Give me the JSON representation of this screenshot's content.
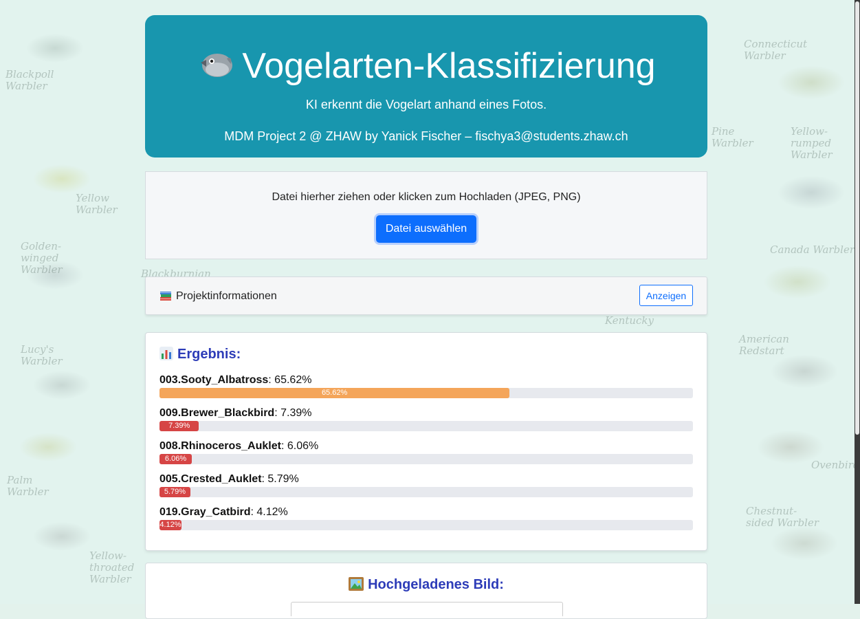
{
  "header": {
    "title": "Vogelarten-Klassifizierung",
    "subtitle": "KI erkennt die Vogelart anhand eines Fotos.",
    "credit": "MDM Project 2 @ ZHAW by Yanick Fischer – fischya3@students.zhaw.ch",
    "icon": "bird-icon",
    "background_color": "#1896ae"
  },
  "upload": {
    "prompt": "Datei hierher ziehen oder klicken zum Hochladen (JPEG, PNG)",
    "button_label": "Datei auswählen",
    "button_color": "#0d6efd"
  },
  "project_info": {
    "label": "Projektinformationen",
    "icon": "books-icon",
    "button_label": "Anzeigen"
  },
  "results": {
    "heading": "Ergebnis:",
    "icon": "bar-chart-icon",
    "heading_color": "#2d3cb8",
    "predictions": [
      {
        "name": "003.Sooty_Albatross",
        "value": "65.62%",
        "percent": 65.62,
        "color": "#f4a55a"
      },
      {
        "name": "009.Brewer_Blackbird",
        "value": "7.39%",
        "percent": 7.39,
        "color": "#d64545"
      },
      {
        "name": "008.Rhinoceros_Auklet",
        "value": "6.06%",
        "percent": 6.06,
        "color": "#d64545"
      },
      {
        "name": "005.Crested_Auklet",
        "value": "5.79%",
        "percent": 5.79,
        "color": "#d64545"
      },
      {
        "name": "019.Gray_Catbird",
        "value": "4.12%",
        "percent": 4.12,
        "color": "#d64545"
      }
    ]
  },
  "uploaded_image": {
    "heading": "Hochgeladenes Bild:",
    "icon": "framed-picture-icon"
  },
  "background_labels": [
    "Blackpoll Warbler",
    "Connecticut Warbler",
    "Yellow Warbler",
    "Golden-winged Warbler",
    "Canada Warbler",
    "Lucy's Warbler",
    "American Redstart",
    "Palm Warbler",
    "Chestnut-sided Warbler",
    "Yellow-throated Warbler",
    "Ovenbird",
    "Yellow-rumped Warbler",
    "Pine Warbler",
    "Blackburnian",
    "Kentucky"
  ]
}
